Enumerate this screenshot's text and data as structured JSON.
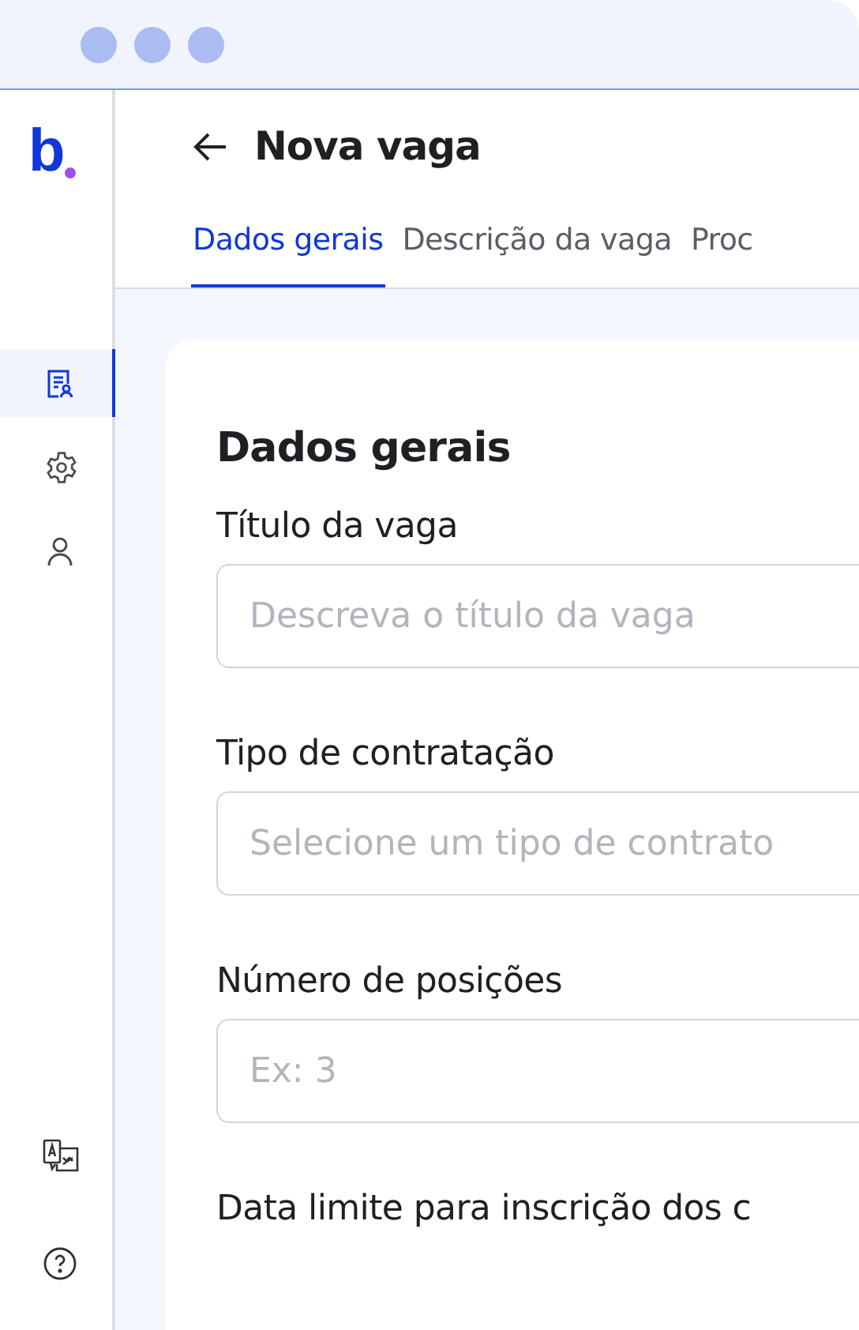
{
  "logo": {
    "text": "b"
  },
  "sidebar": {
    "items": [
      {
        "kind": "document",
        "selected": true
      },
      {
        "kind": "settings",
        "selected": false
      },
      {
        "kind": "user",
        "selected": false
      }
    ],
    "bottom_items": [
      {
        "kind": "translate"
      },
      {
        "kind": "help"
      }
    ]
  },
  "header": {
    "title": "Nova vaga"
  },
  "tabs": [
    {
      "label": "Dados gerais",
      "selected": true
    },
    {
      "label": "Descrição da vaga",
      "selected": false
    },
    {
      "label": "Proc",
      "selected": false
    }
  ],
  "form": {
    "title": "Dados gerais",
    "fields": [
      {
        "label": "Título da vaga",
        "placeholder": "Descreva o título da vaga"
      },
      {
        "label": "Tipo de contratação",
        "placeholder": "Selecione um tipo de contrato"
      },
      {
        "label": "Número de posições",
        "placeholder": "Ex: 3"
      },
      {
        "label": "Data limite para inscrição dos c"
      }
    ]
  }
}
